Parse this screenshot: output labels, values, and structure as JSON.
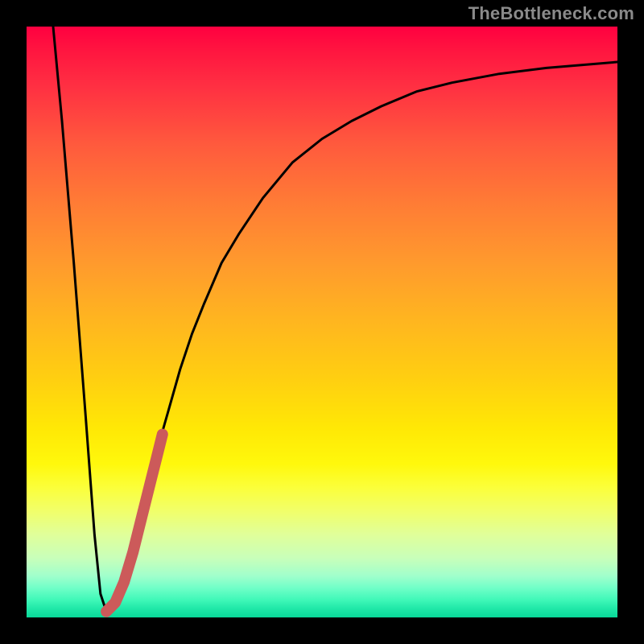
{
  "watermark": "TheBottleneck.com",
  "colors": {
    "background": "#000000",
    "curve_stroke": "#000000",
    "highlight_stroke": "#cc5a5a",
    "watermark_text": "#8a8a8a"
  },
  "chart_data": {
    "type": "line",
    "title": "",
    "xlabel": "",
    "ylabel": "",
    "xlim": [
      0,
      100
    ],
    "ylim": [
      0,
      100
    ],
    "grid": false,
    "legend": false,
    "series": [
      {
        "name": "bottleneck-curve",
        "x": [
          4.5,
          6,
          8,
          10,
          11.5,
          12.5,
          13.5,
          14.5,
          16,
          18,
          20,
          22,
          24,
          26,
          28,
          30,
          33,
          36,
          40,
          45,
          50,
          55,
          60,
          66,
          72,
          80,
          88,
          100
        ],
        "y": [
          100,
          84,
          60,
          34,
          14,
          4,
          1,
          1.5,
          5,
          12,
          20,
          28,
          35,
          42,
          48,
          53,
          60,
          65,
          71,
          77,
          81,
          84,
          86.5,
          89,
          90.5,
          92,
          93,
          94
        ]
      },
      {
        "name": "highlight-segment",
        "x": [
          13.5,
          15,
          16.5,
          18,
          19.5,
          21,
          22,
          23
        ],
        "y": [
          1,
          2.5,
          6,
          11,
          17,
          23,
          27,
          31
        ]
      }
    ]
  }
}
